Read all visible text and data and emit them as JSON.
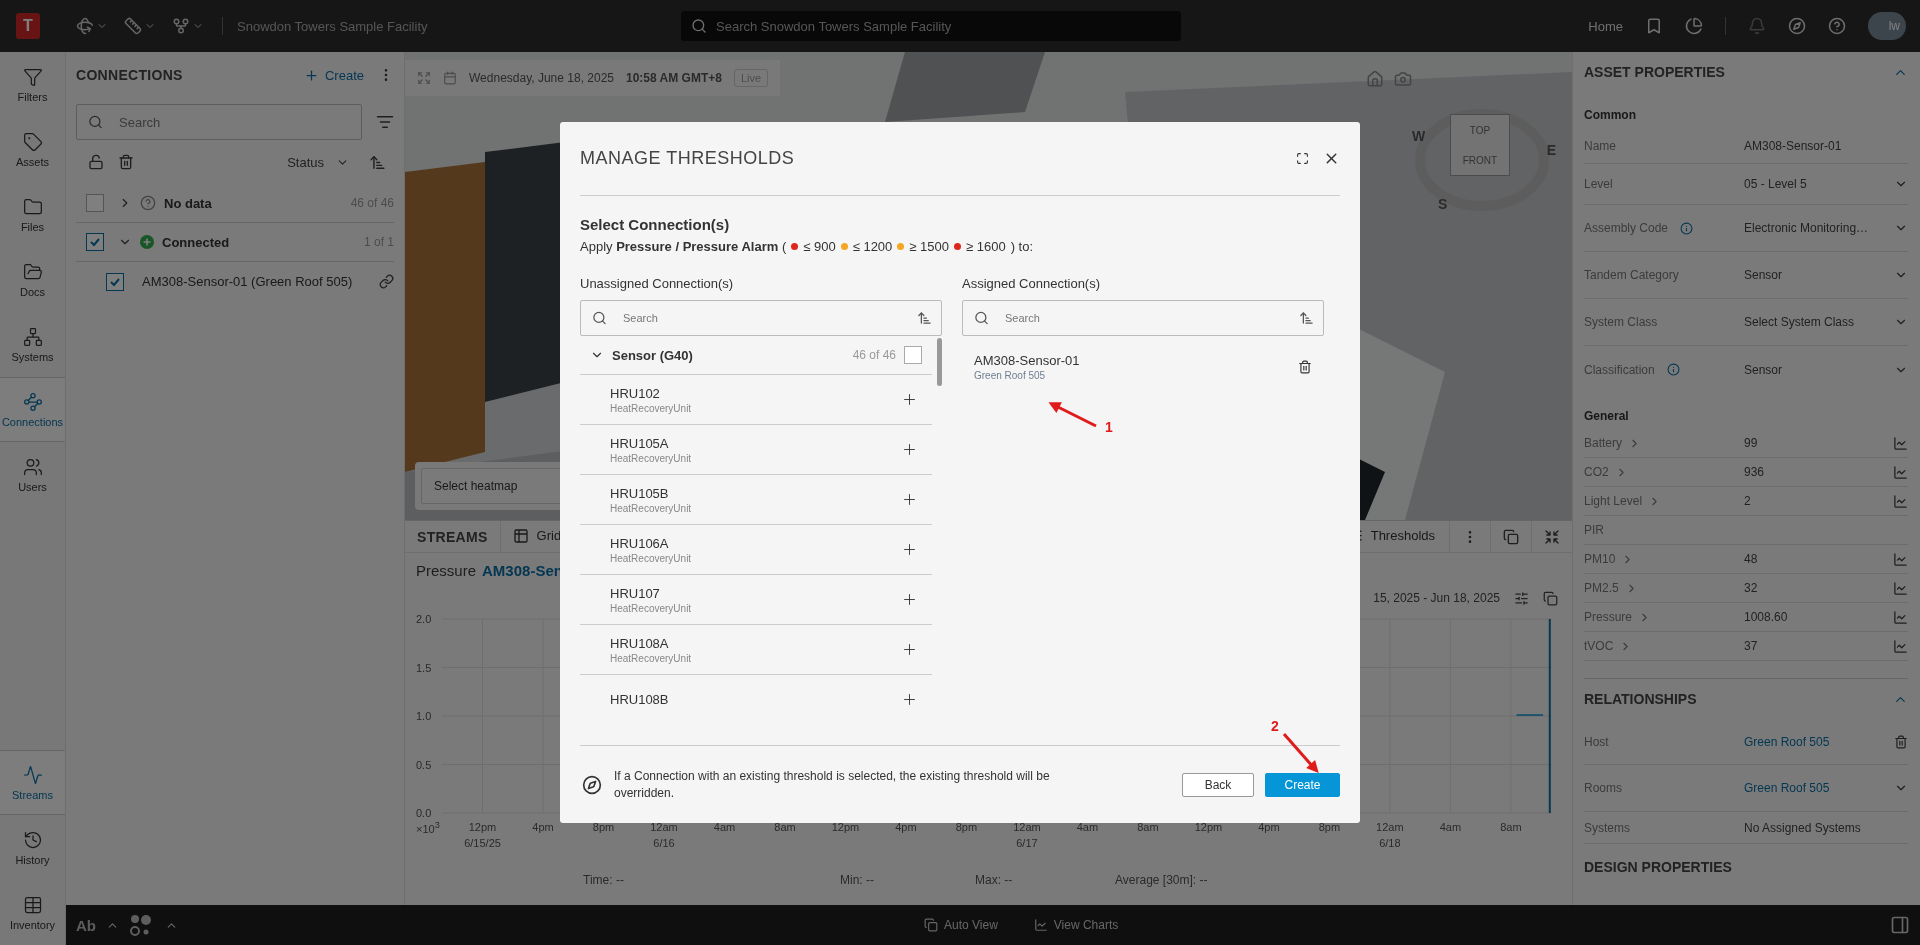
{
  "top_bar": {
    "logo": "T",
    "facility": "Snowdon Towers Sample Facility",
    "search": {
      "placeholder": "Search Snowdon Towers Sample Facility"
    },
    "home": "Home",
    "avatar": "lw"
  },
  "rail": {
    "items": [
      {
        "label": "Filters",
        "kind": "filters",
        "selected": false
      },
      {
        "label": "Assets",
        "kind": "assets",
        "selected": false
      },
      {
        "label": "Files",
        "kind": "files",
        "selected": false
      },
      {
        "label": "Docs",
        "kind": "docs",
        "selected": false
      },
      {
        "label": "Systems",
        "kind": "systems",
        "selected": false
      },
      {
        "label": "Connections",
        "kind": "connections",
        "selected": true
      },
      {
        "label": "Users",
        "kind": "users",
        "selected": false
      }
    ],
    "bottom_items": [
      {
        "label": "Streams",
        "kind": "streams",
        "selected": true
      },
      {
        "label": "History",
        "kind": "history",
        "selected": false
      },
      {
        "label": "Inventory",
        "kind": "inventory",
        "selected": false
      }
    ]
  },
  "connections": {
    "title": "CONNECTIONS",
    "create": "Create",
    "search": {
      "placeholder": "Search"
    },
    "sort": "Status",
    "groups": [
      {
        "label": "No data",
        "kind": "nodata",
        "count": "46 of 46",
        "checked": false,
        "expanded": false
      },
      {
        "label": "Connected",
        "kind": "connected",
        "count": "1 of 1",
        "checked": true,
        "expanded": true,
        "children": [
          {
            "label": "AM308-Sensor-01 (Green Roof 505)",
            "checked": true
          }
        ]
      }
    ]
  },
  "viewer": {
    "date": "Wednesday, June 18, 2025",
    "time": "10:58 AM GMT+8",
    "live": "Live",
    "cube_top": "TOP",
    "cube_front": "FRONT",
    "compass": [
      "W",
      "E",
      "S"
    ],
    "heatmap": {
      "placeholder": "Select heatmap"
    }
  },
  "streams": {
    "title": "STREAMS",
    "tabs": [
      {
        "label": "Grid",
        "selected": false
      }
    ],
    "thresholds": "Thresholds",
    "metric": "Pressure",
    "asset": "AM308-Sen",
    "range": "15, 2025 - Jun 18, 2025",
    "y_labels": [
      "2.0",
      "1.5",
      "1.0",
      "0.5",
      "0.0"
    ],
    "y_unit": "×10$^{3}$",
    "x_labels": [
      {
        "time": "12pm",
        "date": "6/15/25"
      },
      {
        "time": "4pm"
      },
      {
        "time": "8pm"
      },
      {
        "time": "12am",
        "date": "6/16"
      },
      {
        "time": "4am"
      },
      {
        "time": "8am"
      },
      {
        "time": "12pm"
      },
      {
        "time": "4pm"
      },
      {
        "time": "8pm"
      },
      {
        "time": "12am",
        "date": "6/17"
      },
      {
        "time": "4am"
      },
      {
        "time": "8am"
      },
      {
        "time": "12pm"
      },
      {
        "time": "4pm"
      },
      {
        "time": "8pm"
      },
      {
        "time": "12am",
        "date": "6/18"
      },
      {
        "time": "4am"
      },
      {
        "time": "8am"
      }
    ],
    "stats": [
      {
        "label": "Time:",
        "value": "--"
      },
      {
        "label": "Min:",
        "value": "--"
      },
      {
        "label": "Max:",
        "value": "--"
      },
      {
        "label": "Average [30m]:",
        "value": "--"
      }
    ]
  },
  "properties": {
    "title": "ASSET PROPERTIES",
    "sections": [
      {
        "title": "Common",
        "rows": [
          {
            "label": "Name",
            "value": "AM308-Sensor-01",
            "kind": "text",
            "info": false
          },
          {
            "label": "Level",
            "value": "05 - Level 5",
            "kind": "select",
            "info": false
          },
          {
            "label": "Assembly Code",
            "value": "Electronic Monitoring…",
            "kind": "select",
            "info": true
          },
          {
            "label": "Tandem Category",
            "value": "Sensor",
            "kind": "select",
            "info": false
          },
          {
            "label": "System Class",
            "value": "Select System Class",
            "kind": "select",
            "info": false
          },
          {
            "label": "Classification",
            "value": "Sensor",
            "kind": "select",
            "info": true
          }
        ]
      },
      {
        "title": "General",
        "rows": [
          {
            "label": "Battery",
            "value": "99",
            "kind": "stream",
            "info": false
          },
          {
            "label": "CO2",
            "value": "936",
            "kind": "stream",
            "info": false
          },
          {
            "label": "Light Level",
            "value": "2",
            "kind": "stream",
            "info": false
          },
          {
            "label": "PIR",
            "kind": "plain",
            "info": false
          },
          {
            "label": "PM10",
            "value": "48",
            "kind": "stream",
            "info": false
          },
          {
            "label": "PM2.5",
            "value": "32",
            "kind": "stream",
            "info": false
          },
          {
            "label": "Pressure",
            "value": "1008.60",
            "kind": "stream",
            "info": false
          },
          {
            "label": "tVOC",
            "value": "37",
            "kind": "stream",
            "info": false
          }
        ]
      }
    ],
    "relationships": {
      "title": "RELATIONSHIPS",
      "rows": [
        {
          "label": "Host",
          "value": "Green Roof 505",
          "kind": "link-delete"
        },
        {
          "label": "Rooms",
          "value": "Green Roof 505",
          "kind": "link-select"
        },
        {
          "label": "Systems",
          "value": "No Assigned Systems",
          "kind": "text"
        }
      ]
    },
    "design": "DESIGN PROPERTIES"
  },
  "bottom_bar": {
    "font": "Ab",
    "auto_view": "Auto View",
    "view_charts": "View Charts"
  },
  "modal": {
    "title": "MANAGE THRESHOLDS",
    "heading": "Select Connection(s)",
    "apply_before": "Apply **Pressure / Pressure Alarm** (",
    "apply_after": ") to:",
    "thresholds": [
      {
        "label": "≤ 900",
        "color": "#e0261c"
      },
      {
        "label": "≤ 1200",
        "color": "#f5a623"
      },
      {
        "label": "≥ 1500",
        "color": "#f5a623"
      },
      {
        "label": "≥ 1600",
        "color": "#e0261c"
      }
    ],
    "unassigned": {
      "title": "Unassigned Connection(s)",
      "search": {
        "placeholder": "Search"
      },
      "group": {
        "label": "Sensor (G40)",
        "count": "46 of 46",
        "expanded": true,
        "checked": false
      },
      "items": [
        {
          "name": "HRU102",
          "type": "HeatRecoveryUnit"
        },
        {
          "name": "HRU105A",
          "type": "HeatRecoveryUnit"
        },
        {
          "name": "HRU105B",
          "type": "HeatRecoveryUnit"
        },
        {
          "name": "HRU106A",
          "type": "HeatRecoveryUnit"
        },
        {
          "name": "HRU107",
          "type": "HeatRecoveryUnit"
        },
        {
          "name": "HRU108A",
          "type": "HeatRecoveryUnit"
        },
        {
          "name": "HRU108B"
        }
      ]
    },
    "assigned": {
      "title": "Assigned Connection(s)",
      "search": {
        "placeholder": "Search"
      },
      "items": [
        {
          "name": "AM308-Sensor-01",
          "type": "Green Roof 505"
        }
      ]
    },
    "note": "If a Connection with an existing threshold is selected, the existing threshold will be overridden.",
    "buttons": [
      {
        "label": "Back",
        "kind": "secondary"
      },
      {
        "label": "Create",
        "kind": "primary"
      }
    ]
  },
  "annotations": [
    {
      "label": "1"
    },
    {
      "label": "2"
    }
  ]
}
